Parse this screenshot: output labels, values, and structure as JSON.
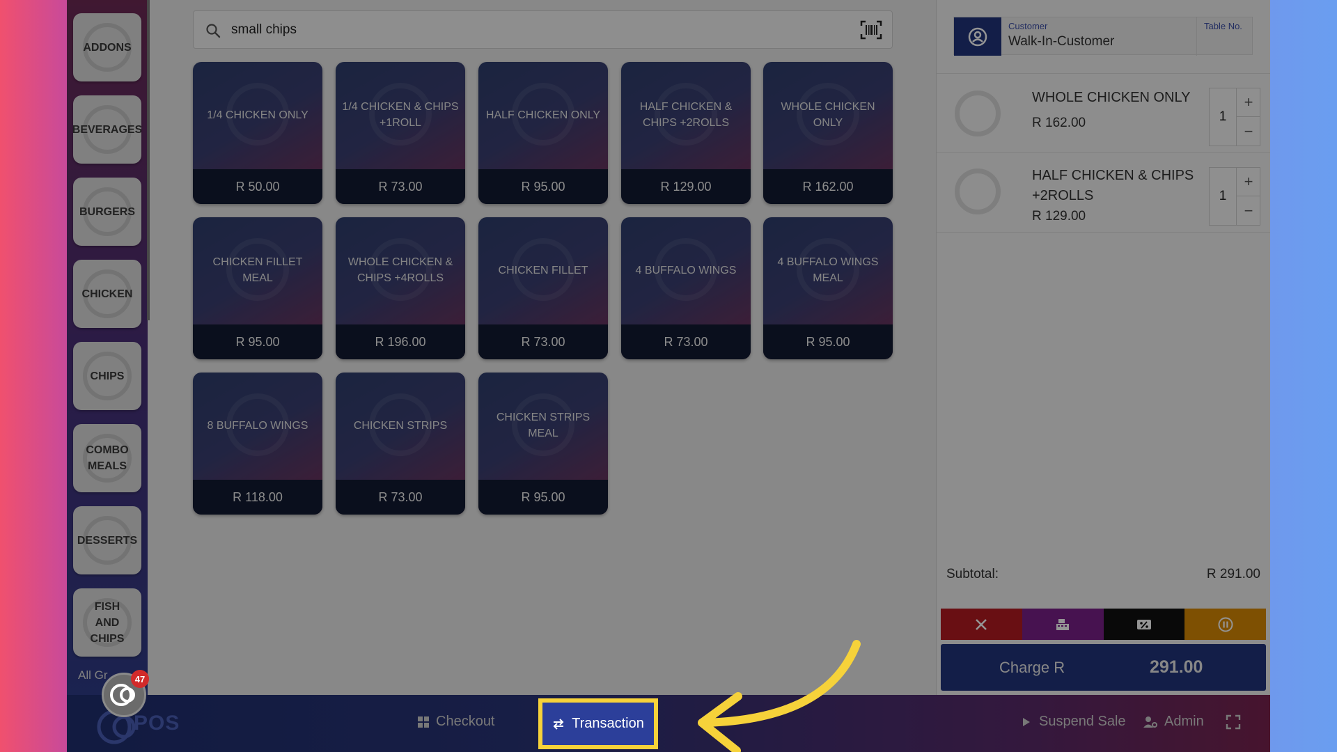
{
  "sidebar": {
    "categories": [
      "ADDONS",
      "BEVERAGES",
      "BURGERS",
      "CHICKEN",
      "CHIPS",
      "COMBO MEALS",
      "DESSERTS",
      "FISH AND CHIPS"
    ],
    "all_groups_label": "All Gr"
  },
  "search": {
    "value": "small chips",
    "placeholder": ""
  },
  "products": [
    {
      "name": "1/4 CHICKEN ONLY",
      "price": "R 50.00"
    },
    {
      "name": "1/4 CHICKEN & CHIPS +1ROLL",
      "price": "R 73.00"
    },
    {
      "name": "HALF CHICKEN ONLY",
      "price": "R 95.00"
    },
    {
      "name": "HALF CHICKEN & CHIPS +2ROLLS",
      "price": "R 129.00"
    },
    {
      "name": "WHOLE CHICKEN ONLY",
      "price": "R 162.00"
    },
    {
      "name": "CHICKEN FILLET MEAL",
      "price": "R 95.00"
    },
    {
      "name": "WHOLE CHICKEN & CHIPS +4ROLLS",
      "price": "R 196.00"
    },
    {
      "name": "CHICKEN FILLET",
      "price": "R 73.00"
    },
    {
      "name": "4 BUFFALO WINGS",
      "price": "R 73.00"
    },
    {
      "name": "4 BUFFALO WINGS MEAL",
      "price": "R 95.00"
    },
    {
      "name": "8 BUFFALO WINGS",
      "price": "R 118.00"
    },
    {
      "name": "CHICKEN STRIPS",
      "price": "R 73.00"
    },
    {
      "name": "CHICKEN STRIPS MEAL",
      "price": "R 95.00"
    }
  ],
  "customer": {
    "label": "Customer",
    "name": "Walk-In-Customer",
    "table_label": "Table No."
  },
  "cart": [
    {
      "name": "WHOLE CHICKEN ONLY",
      "price": "R 162.00",
      "qty": "1"
    },
    {
      "name": "HALF CHICKEN & CHIPS +2ROLLS",
      "price": "R 129.00",
      "qty": "1"
    }
  ],
  "summary": {
    "subtotal_label": "Subtotal:",
    "subtotal_value": "R 291.00",
    "charge_label": "Charge R",
    "charge_amount": "291.00"
  },
  "actions": {
    "colors": [
      "#b51a22",
      "#7a1f8a",
      "#111111",
      "#d98a05"
    ]
  },
  "bottombar": {
    "logo_text": "POS",
    "checkout_label": "Checkout",
    "transaction_label": "Transaction",
    "suspend_label": "Suspend Sale",
    "admin_label": "Admin"
  },
  "notification_badge": "47",
  "colors": {
    "brand_navy": "#22357d",
    "highlight": "#f6d23a",
    "arrow": "#f6d23a"
  }
}
